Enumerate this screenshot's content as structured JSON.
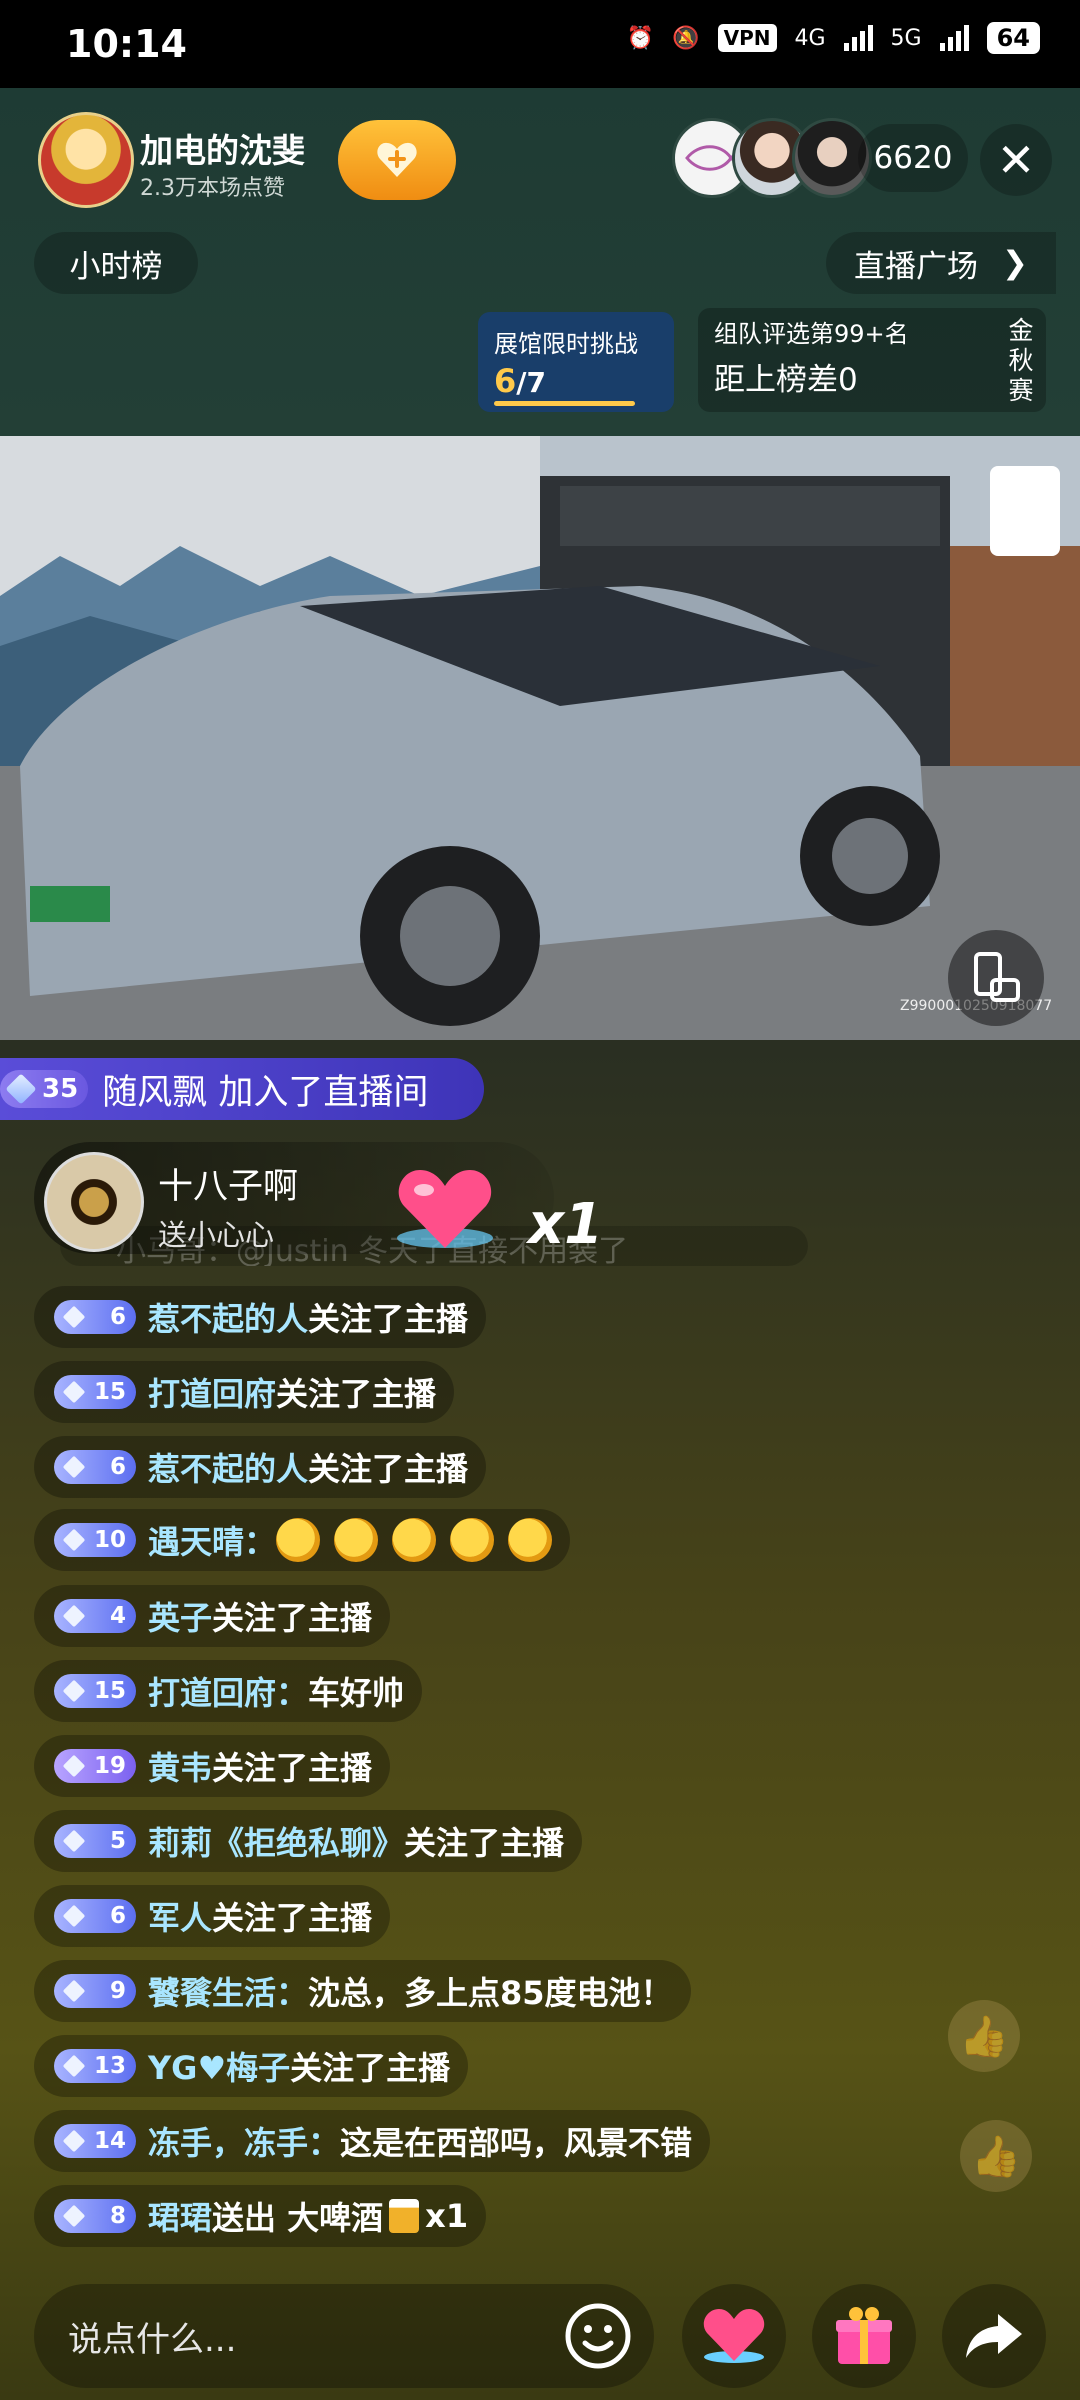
{
  "status_bar": {
    "time": "10:14",
    "vpn": "VPN",
    "net1": "4G",
    "net2": "5G",
    "battery": "64"
  },
  "host": {
    "name": "加电的沈斐",
    "likes": "2.3万本场点赞"
  },
  "viewer_count": "6620",
  "hourly_rank": "小时榜",
  "live_plaza": "直播广场",
  "challenge": {
    "title": "展馆限时挑战",
    "current": "6",
    "total": "/7",
    "progress_fraction": 0.857
  },
  "rank": {
    "title": "组队评选第99+名",
    "gap": "距上榜差0",
    "side": "金秋赛"
  },
  "video": {
    "code": "Z9900010250918077"
  },
  "join_banner": {
    "level": "35",
    "text": "随风飘 加入了直播间"
  },
  "gift": {
    "user": "十八子啊",
    "desc": "送小心心",
    "count": "x1",
    "ghost": "小马哥：@Justin 冬天了直接不用装了"
  },
  "comments": [
    {
      "level": "6",
      "name": "惹不起的人",
      "text": " 关注了主播"
    },
    {
      "level": "15",
      "name": "打道回府",
      "text": " 关注了主播"
    },
    {
      "level": "6",
      "name": "惹不起的人",
      "text": " 关注了主播"
    },
    {
      "level": "10",
      "name": "遇天晴：",
      "text": ""
    },
    {
      "level": "4",
      "name": "英子",
      "text": " 关注了主播"
    },
    {
      "level": "15",
      "name": "打道回府：",
      "text": "车好帅"
    },
    {
      "level": "19",
      "name": "黄韦",
      "text": " 关注了主播"
    },
    {
      "level": "5",
      "name": "莉莉《拒绝私聊》",
      "text": " 关注了主播"
    },
    {
      "level": "6",
      "name": "军人",
      "text": " 关注了主播"
    },
    {
      "level": "9",
      "name": "饕餮生活：",
      "text": "沈总，多上点85度电池！"
    },
    {
      "level": "13",
      "name": "YG♥梅子",
      "text": " 关注了主播"
    },
    {
      "level": "14",
      "name": "冻手，冻手：",
      "text": "这是在西部吗，风景不错"
    },
    {
      "level": "8",
      "name": "珺珺",
      "text": " 送出 大啤酒",
      "suffix": "x1"
    }
  ],
  "input_placeholder": "说点什么...",
  "colors": {
    "accent_orange": "#f6a21e",
    "name_blue": "#a9e6ff",
    "join_purple": "#5a4dd8"
  }
}
